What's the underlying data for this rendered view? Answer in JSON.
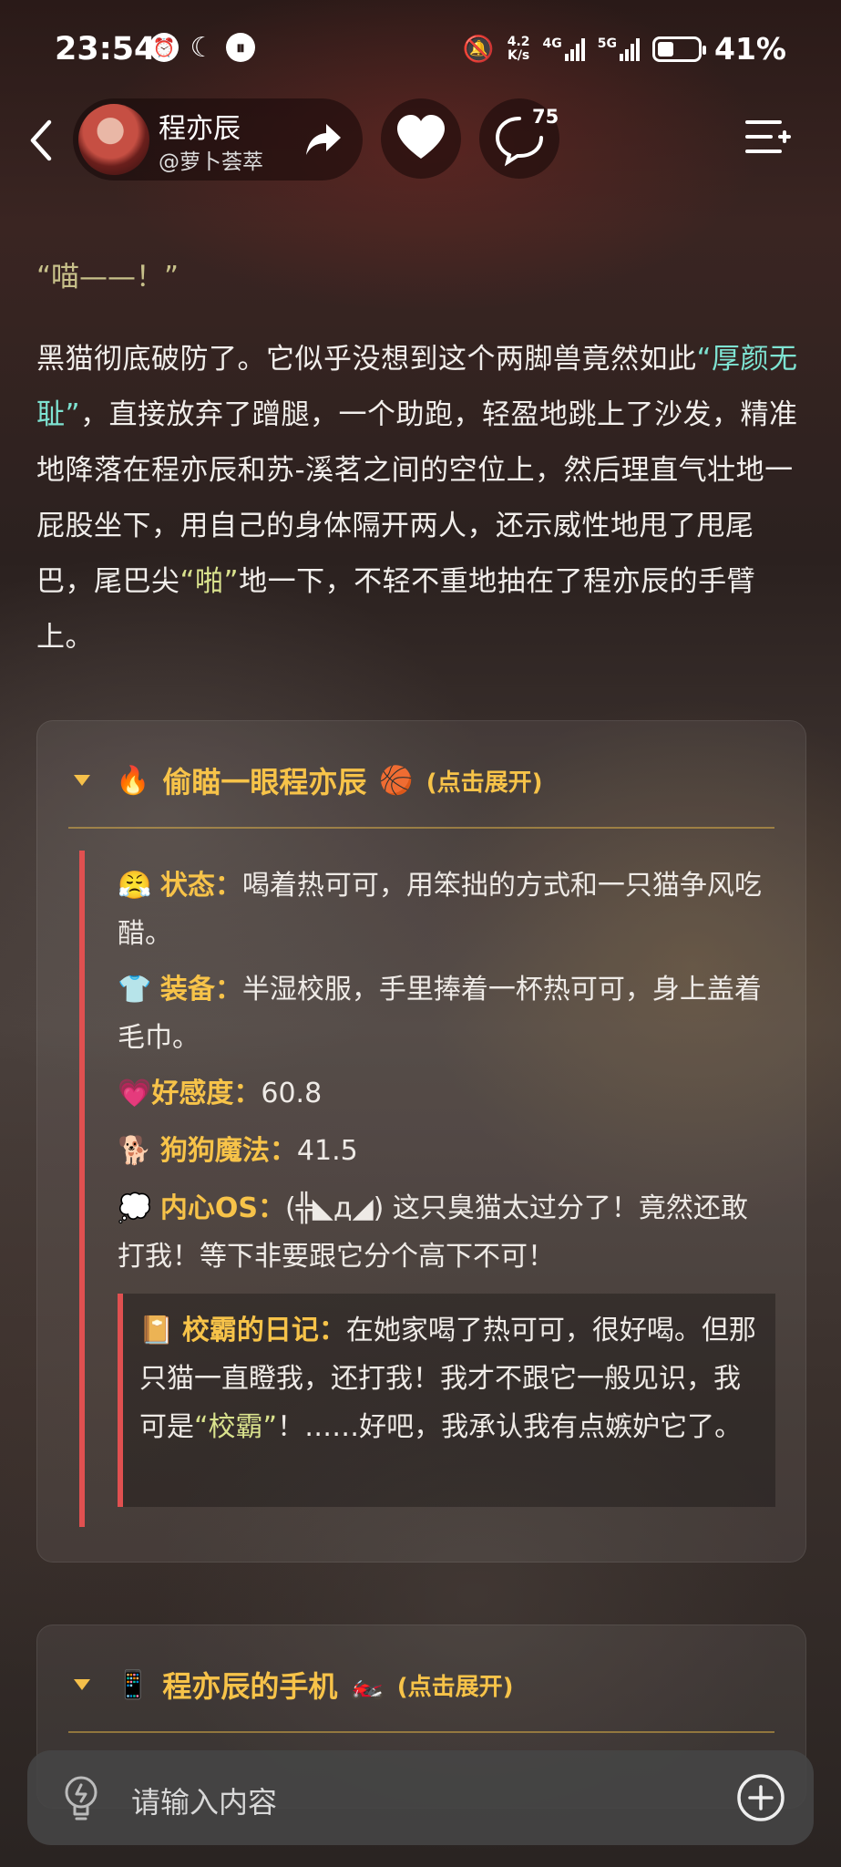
{
  "status_bar": {
    "time": "23:54",
    "net_speed_top": "4.2",
    "net_speed_bottom": "K/s",
    "sig1": "4G",
    "sig2": "5G",
    "battery_pct": "41%",
    "battery_level": 0.41,
    "icons_left": [
      "alarm-icon",
      "moon-icon",
      "pause-icon"
    ]
  },
  "header": {
    "name": "程亦辰",
    "handle": "@萝卜荟萃",
    "comment_count": "75"
  },
  "content": {
    "meow": "“喵——！”",
    "para_1": "黑猫彻底破防了。它似乎没想到这个两脚兽竟然如此",
    "para_hl": "“厚颜无耻”",
    "para_2": "，直接放弃了蹭腿，一个助跑，轻盈地跳上了沙发，精准地降落在程亦辰和苏-溪茗之间的空位上，然后理直气壮地一屁股坐下，用自己的身体隔开两人，还示威性地甩了甩尾巴，尾巴尖",
    "para_hl2": "“啪”",
    "para_3": "地一下，不轻不重地抽在了程亦辰的手臂上。"
  },
  "card1": {
    "emoji_left": "🔥",
    "title": "偷瞄一眼程亦辰",
    "emoji_right": "🏀",
    "sub": "(点击展开)",
    "status_emoji": "😤",
    "status_label": "状态：",
    "status_value": "喝着热可可，用笨拙的方式和一只猫争风吃醋。",
    "equip_emoji": "👕",
    "equip_label": "装备：",
    "equip_value": "半湿校服，手里捧着一杯热可可，身上盖着毛巾。",
    "fav_emoji": "💗",
    "fav_label": "好感度：",
    "fav_value": "60.8",
    "dog_emoji": "🐕",
    "dog_label": "狗狗魔法：",
    "dog_value": "41.5",
    "os_emoji": "💭",
    "os_label": "内心OS：",
    "os_value": "(╬◣д◢) 这只臭猫太过分了！竟然还敢打我！等下非要跟它分个高下不可！",
    "diary_emoji": "📔",
    "diary_label": "校霸的日记：",
    "diary_1": "在她家喝了热可可，很好喝。但那只猫一直瞪我，还打我！我才不跟它一般见识，我可是",
    "diary_hl": "“校霸”",
    "diary_2": "！……好吧，我承认我有点嫉妒它了。"
  },
  "card2": {
    "emoji_left": "📱",
    "title": "程亦辰的手机",
    "emoji_right": "🏍️",
    "sub": "(点击展开)"
  },
  "input": {
    "placeholder": "请输入内容"
  }
}
